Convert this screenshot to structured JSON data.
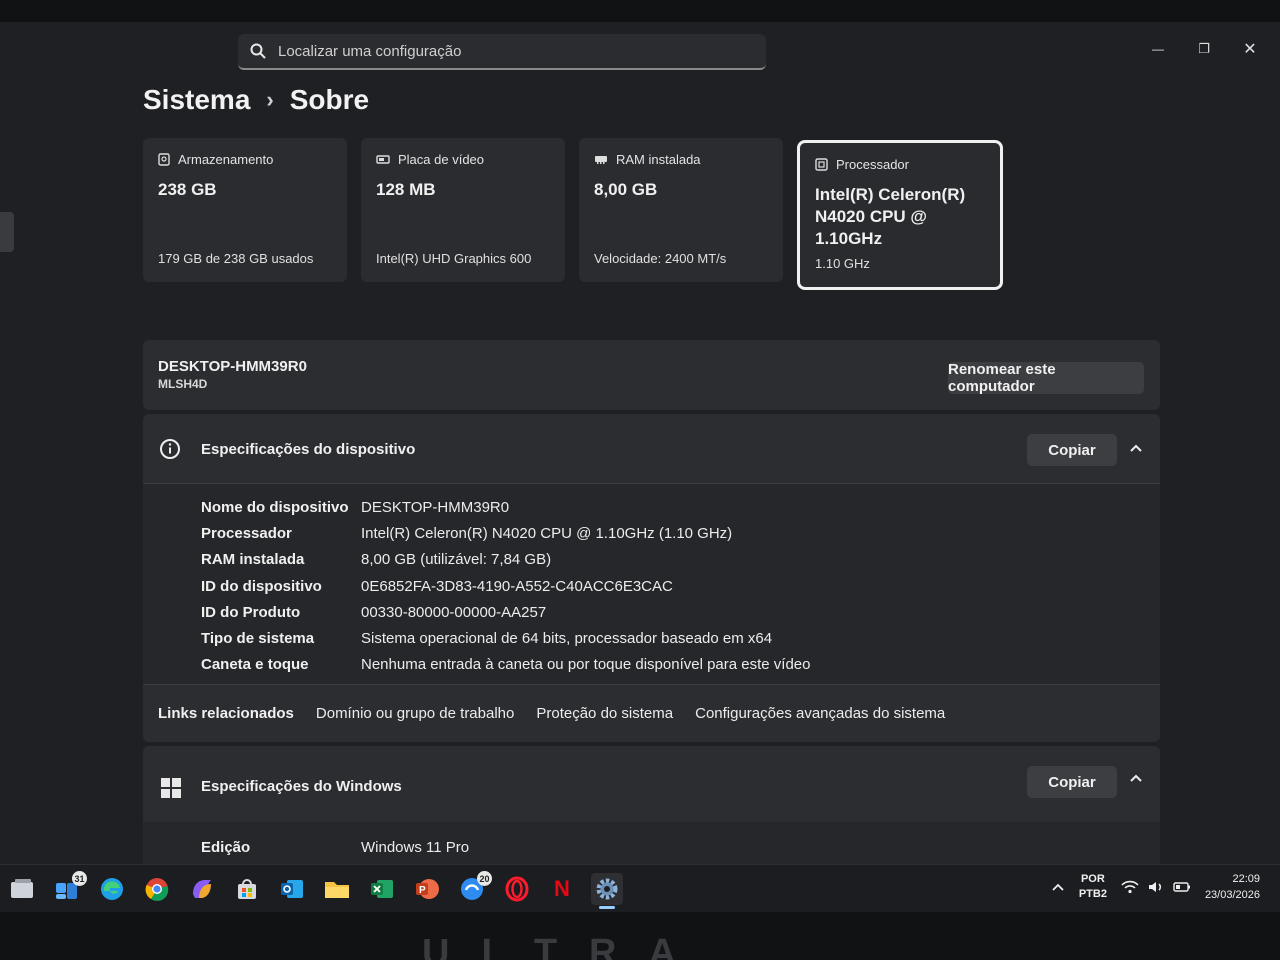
{
  "search": {
    "placeholder": "Localizar uma configuração"
  },
  "window_controls": {
    "minimize": "—",
    "restore": "❐",
    "close": "✕"
  },
  "breadcrumb": {
    "parent": "Sistema",
    "separator": "›",
    "current": "Sobre"
  },
  "cards": [
    {
      "title": "Armazenamento",
      "value": "238 GB",
      "sub": "179 GB de 238 GB usados",
      "icon": "storage-icon"
    },
    {
      "title": "Placa de vídeo",
      "value": "128 MB",
      "sub": "Intel(R) UHD Graphics 600",
      "icon": "gpu-icon"
    },
    {
      "title": "RAM instalada",
      "value": "8,00 GB",
      "sub": "Velocidade: 2400 MT/s",
      "icon": "ram-icon"
    },
    {
      "title": "Processador",
      "value": "Intel(R) Celeron(R) N4020 CPU @ 1.10GHz",
      "sub": "1.10 GHz",
      "icon": "cpu-icon"
    }
  ],
  "device": {
    "name": "DESKTOP-HMM39R0",
    "model": "MLSH4D",
    "rename_label": "Renomear este computador"
  },
  "device_specs": {
    "title": "Especificações do dispositivo",
    "copy_label": "Copiar",
    "rows": [
      {
        "key": "Nome do dispositivo",
        "value": "DESKTOP-HMM39R0"
      },
      {
        "key": "Processador",
        "value": "Intel(R) Celeron(R) N4020 CPU @ 1.10GHz (1.10 GHz)"
      },
      {
        "key": "RAM instalada",
        "value": "8,00 GB (utilizável: 7,84 GB)"
      },
      {
        "key": "ID do dispositivo",
        "value": "0E6852FA-3D83-4190-A552-C40ACC6E3CAC"
      },
      {
        "key": "ID do Produto",
        "value": "00330-80000-00000-AA257"
      },
      {
        "key": "Tipo de sistema",
        "value": "Sistema operacional de 64 bits, processador baseado em x64"
      },
      {
        "key": "Caneta e toque",
        "value": "Nenhuma entrada à caneta ou por toque disponível para este vídeo"
      }
    ]
  },
  "related_links": {
    "label": "Links relacionados",
    "links": [
      "Domínio ou grupo de trabalho",
      "Proteção do sistema",
      "Configurações avançadas do sistema"
    ]
  },
  "windows_specs": {
    "title": "Especificações do Windows",
    "copy_label": "Copiar",
    "rows": [
      {
        "key": "Edição",
        "value": "Windows 11 Pro"
      }
    ]
  },
  "taskbar": {
    "apps": [
      {
        "name": "task-view",
        "badge": ""
      },
      {
        "name": "widgets",
        "badge": "31"
      },
      {
        "name": "edge",
        "badge": ""
      },
      {
        "name": "chrome",
        "badge": ""
      },
      {
        "name": "copilot",
        "badge": ""
      },
      {
        "name": "microsoft-store",
        "badge": ""
      },
      {
        "name": "outlook",
        "badge": ""
      },
      {
        "name": "file-explorer",
        "badge": ""
      },
      {
        "name": "excel",
        "badge": ""
      },
      {
        "name": "powerpoint",
        "badge": ""
      },
      {
        "name": "teams",
        "badge": "20"
      },
      {
        "name": "opera",
        "badge": ""
      },
      {
        "name": "netflix",
        "badge": ""
      },
      {
        "name": "settings",
        "badge": ""
      }
    ],
    "netflix_letter": "N",
    "lang_1": "POR",
    "lang_2": "PTB2",
    "time": "22:09",
    "date": "23/03/2026"
  },
  "bezel_text": "ULTRA",
  "colors": {
    "accent": "#9ad0ff",
    "card_bg": "#2b2c30",
    "window_bg": "#1f2023"
  }
}
